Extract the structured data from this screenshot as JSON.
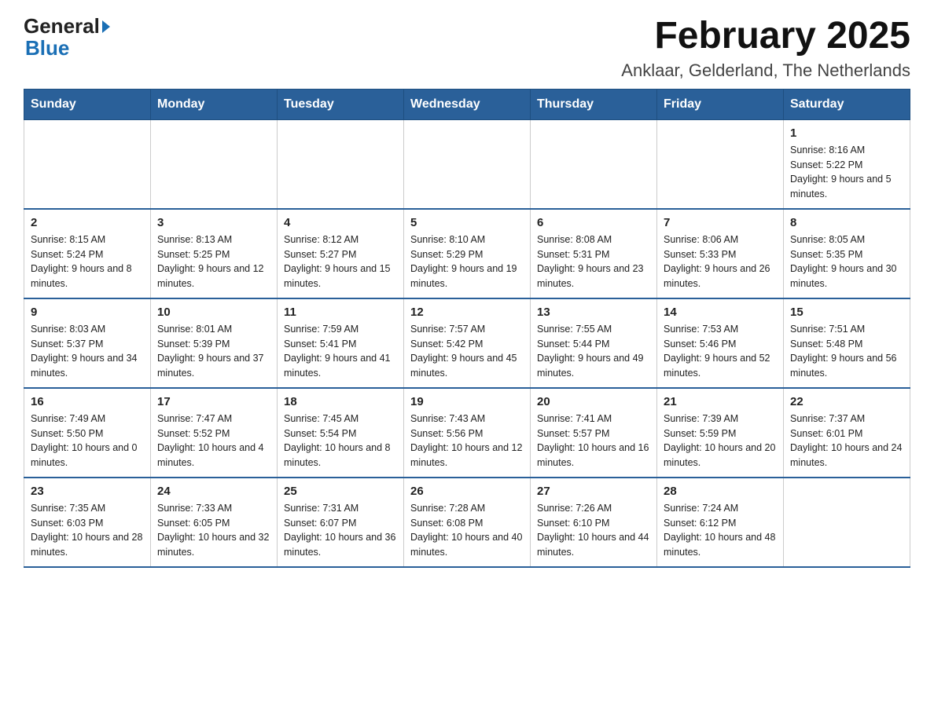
{
  "header": {
    "logo_general": "General",
    "logo_blue": "Blue",
    "title": "February 2025",
    "subtitle": "Anklaar, Gelderland, The Netherlands"
  },
  "weekdays": [
    "Sunday",
    "Monday",
    "Tuesday",
    "Wednesday",
    "Thursday",
    "Friday",
    "Saturday"
  ],
  "weeks": [
    [
      {
        "day": "",
        "info": ""
      },
      {
        "day": "",
        "info": ""
      },
      {
        "day": "",
        "info": ""
      },
      {
        "day": "",
        "info": ""
      },
      {
        "day": "",
        "info": ""
      },
      {
        "day": "",
        "info": ""
      },
      {
        "day": "1",
        "info": "Sunrise: 8:16 AM\nSunset: 5:22 PM\nDaylight: 9 hours and 5 minutes."
      }
    ],
    [
      {
        "day": "2",
        "info": "Sunrise: 8:15 AM\nSunset: 5:24 PM\nDaylight: 9 hours and 8 minutes."
      },
      {
        "day": "3",
        "info": "Sunrise: 8:13 AM\nSunset: 5:25 PM\nDaylight: 9 hours and 12 minutes."
      },
      {
        "day": "4",
        "info": "Sunrise: 8:12 AM\nSunset: 5:27 PM\nDaylight: 9 hours and 15 minutes."
      },
      {
        "day": "5",
        "info": "Sunrise: 8:10 AM\nSunset: 5:29 PM\nDaylight: 9 hours and 19 minutes."
      },
      {
        "day": "6",
        "info": "Sunrise: 8:08 AM\nSunset: 5:31 PM\nDaylight: 9 hours and 23 minutes."
      },
      {
        "day": "7",
        "info": "Sunrise: 8:06 AM\nSunset: 5:33 PM\nDaylight: 9 hours and 26 minutes."
      },
      {
        "day": "8",
        "info": "Sunrise: 8:05 AM\nSunset: 5:35 PM\nDaylight: 9 hours and 30 minutes."
      }
    ],
    [
      {
        "day": "9",
        "info": "Sunrise: 8:03 AM\nSunset: 5:37 PM\nDaylight: 9 hours and 34 minutes."
      },
      {
        "day": "10",
        "info": "Sunrise: 8:01 AM\nSunset: 5:39 PM\nDaylight: 9 hours and 37 minutes."
      },
      {
        "day": "11",
        "info": "Sunrise: 7:59 AM\nSunset: 5:41 PM\nDaylight: 9 hours and 41 minutes."
      },
      {
        "day": "12",
        "info": "Sunrise: 7:57 AM\nSunset: 5:42 PM\nDaylight: 9 hours and 45 minutes."
      },
      {
        "day": "13",
        "info": "Sunrise: 7:55 AM\nSunset: 5:44 PM\nDaylight: 9 hours and 49 minutes."
      },
      {
        "day": "14",
        "info": "Sunrise: 7:53 AM\nSunset: 5:46 PM\nDaylight: 9 hours and 52 minutes."
      },
      {
        "day": "15",
        "info": "Sunrise: 7:51 AM\nSunset: 5:48 PM\nDaylight: 9 hours and 56 minutes."
      }
    ],
    [
      {
        "day": "16",
        "info": "Sunrise: 7:49 AM\nSunset: 5:50 PM\nDaylight: 10 hours and 0 minutes."
      },
      {
        "day": "17",
        "info": "Sunrise: 7:47 AM\nSunset: 5:52 PM\nDaylight: 10 hours and 4 minutes."
      },
      {
        "day": "18",
        "info": "Sunrise: 7:45 AM\nSunset: 5:54 PM\nDaylight: 10 hours and 8 minutes."
      },
      {
        "day": "19",
        "info": "Sunrise: 7:43 AM\nSunset: 5:56 PM\nDaylight: 10 hours and 12 minutes."
      },
      {
        "day": "20",
        "info": "Sunrise: 7:41 AM\nSunset: 5:57 PM\nDaylight: 10 hours and 16 minutes."
      },
      {
        "day": "21",
        "info": "Sunrise: 7:39 AM\nSunset: 5:59 PM\nDaylight: 10 hours and 20 minutes."
      },
      {
        "day": "22",
        "info": "Sunrise: 7:37 AM\nSunset: 6:01 PM\nDaylight: 10 hours and 24 minutes."
      }
    ],
    [
      {
        "day": "23",
        "info": "Sunrise: 7:35 AM\nSunset: 6:03 PM\nDaylight: 10 hours and 28 minutes."
      },
      {
        "day": "24",
        "info": "Sunrise: 7:33 AM\nSunset: 6:05 PM\nDaylight: 10 hours and 32 minutes."
      },
      {
        "day": "25",
        "info": "Sunrise: 7:31 AM\nSunset: 6:07 PM\nDaylight: 10 hours and 36 minutes."
      },
      {
        "day": "26",
        "info": "Sunrise: 7:28 AM\nSunset: 6:08 PM\nDaylight: 10 hours and 40 minutes."
      },
      {
        "day": "27",
        "info": "Sunrise: 7:26 AM\nSunset: 6:10 PM\nDaylight: 10 hours and 44 minutes."
      },
      {
        "day": "28",
        "info": "Sunrise: 7:24 AM\nSunset: 6:12 PM\nDaylight: 10 hours and 48 minutes."
      },
      {
        "day": "",
        "info": ""
      }
    ]
  ]
}
